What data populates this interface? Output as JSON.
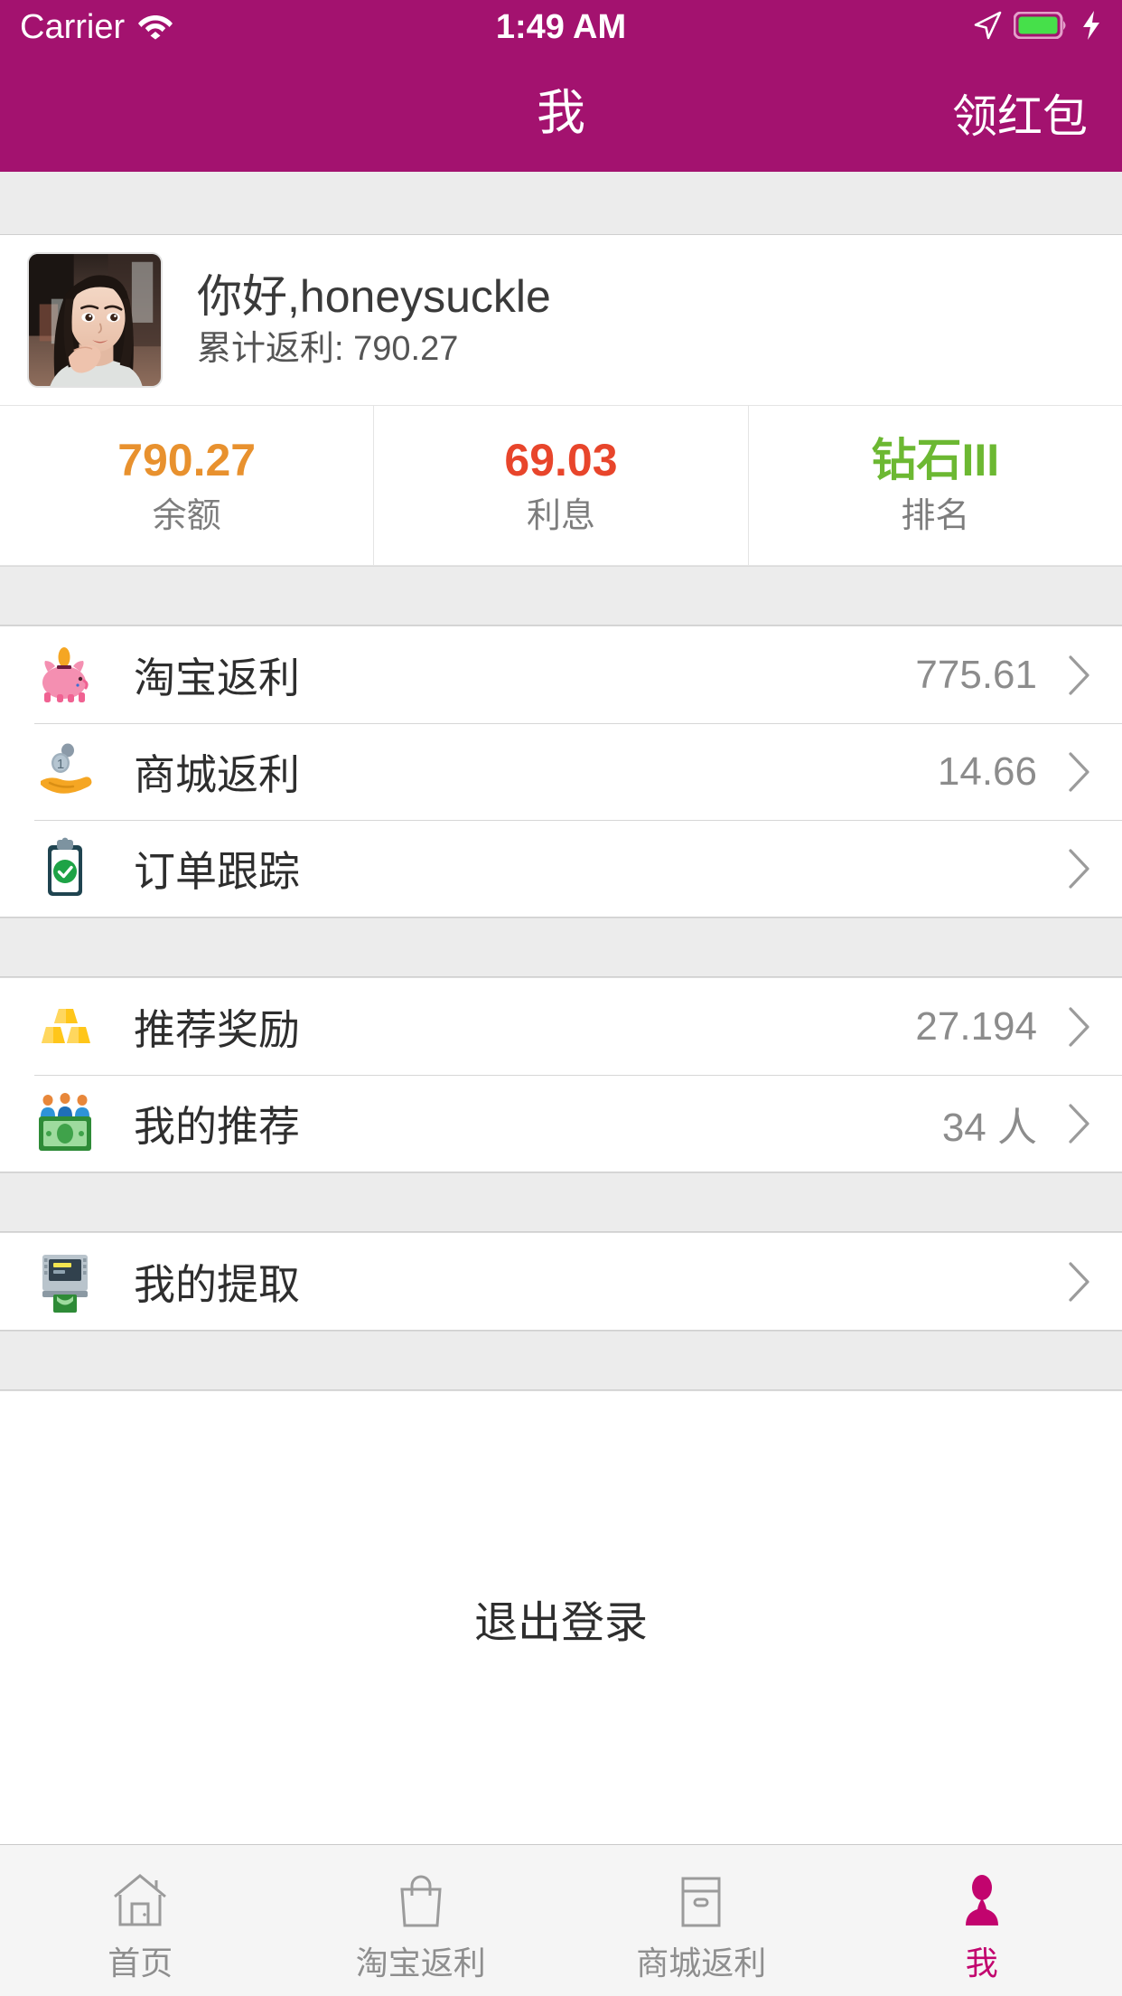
{
  "theme": {
    "header_bg": "#a3126f",
    "accent": "#c2046e",
    "balance_color": "#e8912e",
    "interest_color": "#e8452b",
    "rank_color": "#6cb832",
    "page_bg": "#ececec",
    "card_bg": "#ffffff"
  },
  "status_bar": {
    "carrier": "Carrier",
    "wifi_icon": "wifi-icon",
    "time": "1:49 AM",
    "location_icon": "location-arrow-icon",
    "battery_icon": "battery-full-icon",
    "charging_icon": "lightning-bolt-icon"
  },
  "nav": {
    "title": "我",
    "right_action": "领红包"
  },
  "profile": {
    "avatar_alt": "user-avatar-photo",
    "greeting": "你好,honeysuckle",
    "total_rebate": "累计返利: 790.27"
  },
  "stats": [
    {
      "value": "790.27",
      "label": "余额",
      "color": "#e8912e",
      "name": "balance"
    },
    {
      "value": "69.03",
      "label": "利息",
      "color": "#e8452b",
      "name": "interest"
    },
    {
      "value": "钻石III",
      "label": "排名",
      "color": "#6cb832",
      "name": "rank"
    }
  ],
  "groups": [
    {
      "name": "rebate-group",
      "rows": [
        {
          "icon": "piggy-bank-icon",
          "label": "淘宝返利",
          "value": "775.61"
        },
        {
          "icon": "coin-in-hand-icon",
          "label": "商城返利",
          "value": "14.66"
        },
        {
          "icon": "clipboard-check-icon",
          "label": "订单跟踪",
          "value": ""
        }
      ]
    },
    {
      "name": "referral-group",
      "rows": [
        {
          "icon": "gold-bars-icon",
          "label": "推荐奖励",
          "value": "27.194"
        },
        {
          "icon": "money-people-icon",
          "label": "我的推荐",
          "value": "34 人"
        }
      ]
    },
    {
      "name": "withdraw-group",
      "rows": [
        {
          "icon": "atm-machine-icon",
          "label": "我的提取",
          "value": ""
        }
      ]
    }
  ],
  "logout": {
    "label": "退出登录"
  },
  "tabs": [
    {
      "icon": "home-icon",
      "label": "首页",
      "active": false
    },
    {
      "icon": "bag-icon",
      "label": "淘宝返利",
      "active": false
    },
    {
      "icon": "store-icon",
      "label": "商城返利",
      "active": false
    },
    {
      "icon": "person-icon",
      "label": "我",
      "active": true
    }
  ]
}
